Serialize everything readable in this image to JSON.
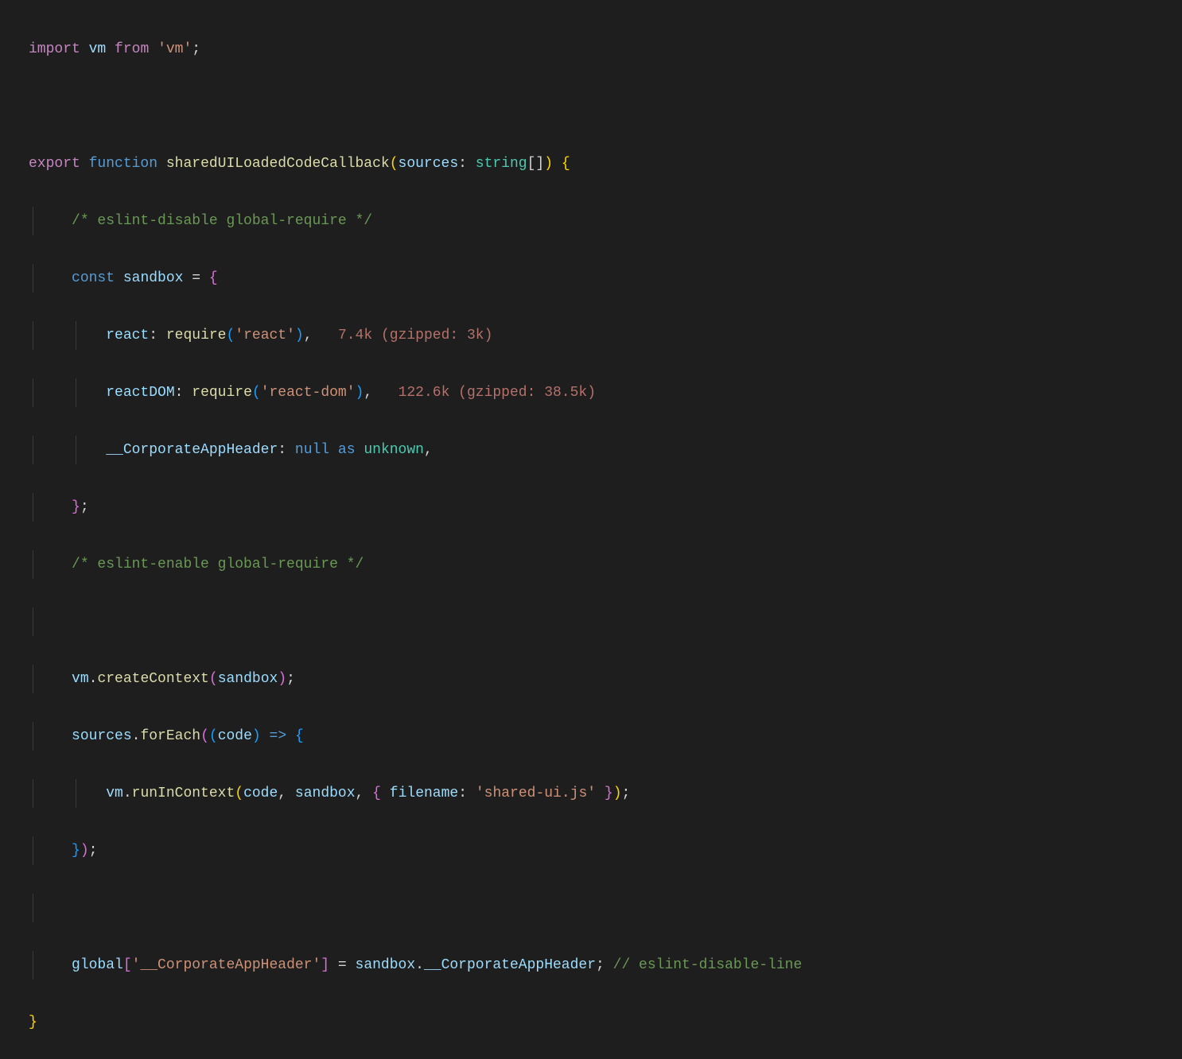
{
  "code": {
    "l1": {
      "import": "import",
      "vm": "vm",
      "from": "from",
      "mod": "'vm'",
      "semi": ";"
    },
    "l3": {
      "export": "export",
      "function": "function",
      "name": "sharedUILoadedCodeCallback",
      "lp": "(",
      "param": "sources",
      "colon": ":",
      "type": "string",
      "brackets": "[]",
      "rp": ")",
      "lb": "{"
    },
    "l4": {
      "comment": "/* eslint-disable global-require */"
    },
    "l5": {
      "const": "const",
      "name": "sandbox",
      "eq": "=",
      "lb": "{"
    },
    "l6": {
      "key": "react",
      "colon": ":",
      "require": "require",
      "lp": "(",
      "mod": "'react'",
      "rp": ")",
      "comma": ",",
      "hint": "7.4k (gzipped: 3k)"
    },
    "l7": {
      "key": "reactDOM",
      "colon": ":",
      "require": "require",
      "lp": "(",
      "mod": "'react-dom'",
      "rp": ")",
      "comma": ",",
      "hint": "122.6k (gzipped: 38.5k)"
    },
    "l8": {
      "key": "__CorporateAppHeader",
      "colon": ":",
      "null": "null",
      "as": "as",
      "type": "unknown",
      "comma": ","
    },
    "l9": {
      "rb": "}",
      "semi": ";"
    },
    "l10": {
      "comment": "/* eslint-enable global-require */"
    },
    "l12": {
      "obj": "vm",
      "dot": ".",
      "method": "createContext",
      "lp": "(",
      "arg": "sandbox",
      "rp": ")",
      "semi": ";"
    },
    "l13": {
      "obj": "sources",
      "dot": ".",
      "method": "forEach",
      "lp1": "(",
      "lp2": "(",
      "param": "code",
      "rp2": ")",
      "arrow": "=>",
      "lb": "{"
    },
    "l14": {
      "obj": "vm",
      "dot": ".",
      "method": "runInContext",
      "lp": "(",
      "a1": "code",
      "c1": ",",
      "a2": "sandbox",
      "c2": ",",
      "lb": "{",
      "key": "filename",
      "colon": ":",
      "val": "'shared-ui.js'",
      "rb": "}",
      "rp": ")",
      "semi": ";"
    },
    "l15": {
      "rb": "}",
      "rp": ")",
      "semi": ";"
    },
    "l17": {
      "obj": "global",
      "lb": "[",
      "key": "'__CorporateAppHeader'",
      "rb": "]",
      "eq": "=",
      "rhs1": "sandbox",
      "dot": ".",
      "rhs2": "__CorporateAppHeader",
      "semi": ";",
      "comment": "// eslint-disable-line"
    },
    "l18": {
      "rb": "}"
    }
  }
}
